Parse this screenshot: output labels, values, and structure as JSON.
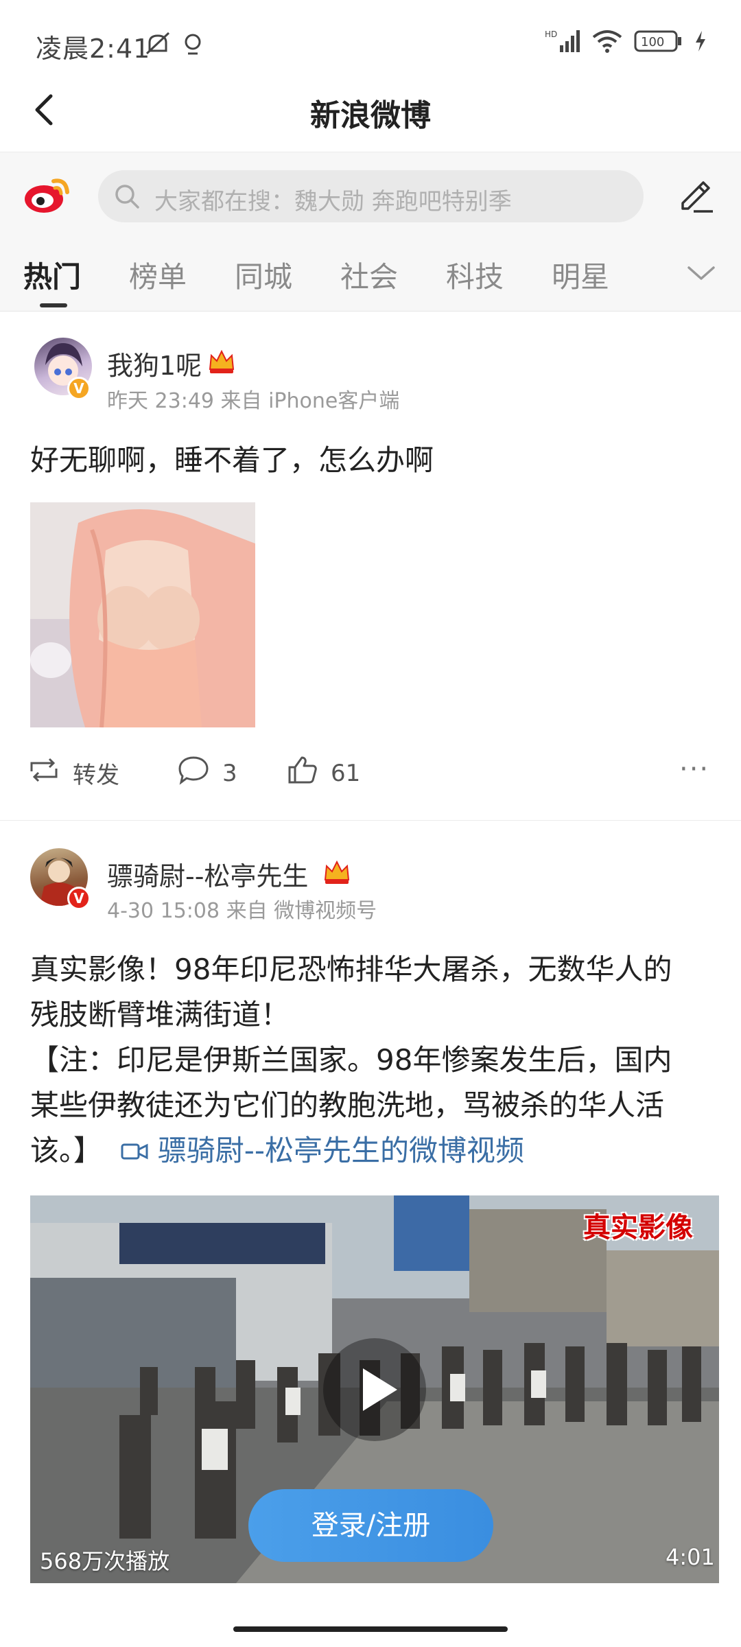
{
  "status_bar": {
    "time": "凌晨2:41",
    "battery": "100",
    "network": "HD"
  },
  "title_bar": {
    "title": "新浪微博"
  },
  "search": {
    "placeholder": "大家都在搜：魏大勋 奔跑吧特别季"
  },
  "tabs": [
    {
      "label": "热门",
      "active": true
    },
    {
      "label": "榜单",
      "active": false
    },
    {
      "label": "同城",
      "active": false
    },
    {
      "label": "社会",
      "active": false
    },
    {
      "label": "科技",
      "active": false
    },
    {
      "label": "明星",
      "active": false
    }
  ],
  "posts": [
    {
      "username": "我狗1呢",
      "meta": "昨天 23:49 来自 iPhone客户端",
      "text": "好无聊啊，睡不着了，怎么办啊",
      "repost_label": "转发",
      "comments": "3",
      "likes": "61"
    },
    {
      "username": "骠骑尉--松亭先生",
      "meta": "4-30 15:08 来自 微博视频号",
      "text_line1": "真实影像！98年印尼恐怖排华大屠杀，无数华人的",
      "text_line2": "残肢断臂堆满街道！",
      "text_line3": "【注：印尼是伊斯兰国家。98年惨案发生后，国内",
      "text_line4": "某些伊教徒还为它们的教胞洗地，骂被杀的华人活",
      "text_line5_prefix": "该。】",
      "video_link": "骠骑尉--松亭先生的微博视频",
      "video": {
        "overlay_tag": "真实影像",
        "play_count": "568万次播放",
        "duration": "4:01"
      }
    }
  ],
  "login_button": "登录/注册",
  "colors": {
    "accent_blue": "#3a8ee0",
    "link": "#3a6ea5",
    "verify_orange": "#f5a623",
    "verify_red": "#e2231a"
  }
}
